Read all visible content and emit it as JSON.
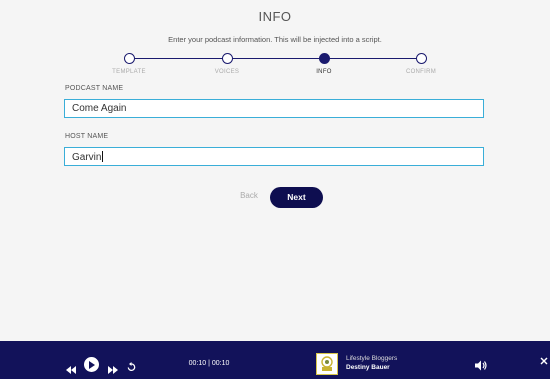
{
  "page": {
    "title": "INFO",
    "subtitle": "Enter your podcast information. This will be injected into a script."
  },
  "stepper": {
    "steps": [
      {
        "label": "TEMPLATE",
        "state": "complete"
      },
      {
        "label": "VOICES",
        "state": "complete"
      },
      {
        "label": "INFO",
        "state": "active"
      },
      {
        "label": "CONFIRM",
        "state": "upcoming"
      }
    ]
  },
  "form": {
    "podcast_name_label": "PODCAST NAME",
    "podcast_name_value": "Come Again",
    "host_name_label": "HOST NAME",
    "host_name_value": "Garvin"
  },
  "actions": {
    "back_label": "Back",
    "next_label": "Next"
  },
  "player": {
    "time_display": "00:10 | 00:10",
    "show_name": "Lifestyle Bloggers",
    "host_name": "Destiny Bauer",
    "icons": [
      "rewind-icon",
      "play-icon",
      "fast-forward-icon",
      "replay-icon",
      "volume-icon",
      "close-icon"
    ]
  },
  "colors": {
    "accent": "#0e0e50",
    "player_bg": "#12125a",
    "input_border": "#3aaed8",
    "page_bg": "#f5f5f5"
  }
}
